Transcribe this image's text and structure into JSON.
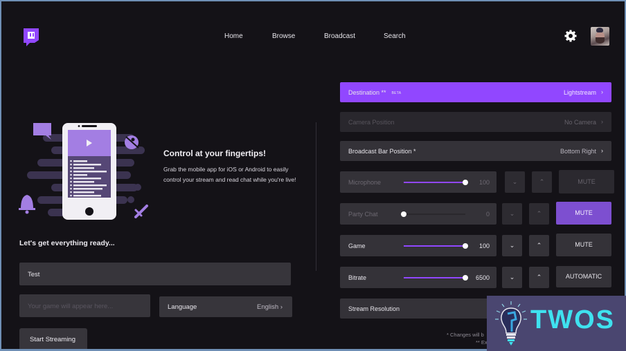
{
  "nav": {
    "links": [
      "Home",
      "Browse",
      "Broadcast",
      "Search"
    ],
    "icons": {
      "logo": "twitch-logo-icon",
      "settings": "gear-icon",
      "avatar": "user-avatar"
    }
  },
  "promo": {
    "title": "Control at your fingertips!",
    "text": "Grab the mobile app for iOS or Android to easily control your stream and read chat while you're live!"
  },
  "setup": {
    "heading": "Let's get everything ready...",
    "title_value": "Test",
    "game_placeholder": "Your game will appear here...",
    "language_label": "Language",
    "language_value": "English",
    "start_button": "Start Streaming"
  },
  "settings": {
    "destination": {
      "label": "Destination **",
      "badge": "BETA",
      "value": "Lightstream"
    },
    "camera": {
      "label": "Camera Position",
      "value": "No Camera"
    },
    "broadcast_bar": {
      "label": "Broadcast Bar Position *",
      "value": "Bottom Right"
    },
    "sliders": [
      {
        "label": "Microphone",
        "value": "100",
        "fraction": 1.0,
        "action": "MUTE",
        "state": "disabled"
      },
      {
        "label": "Party Chat",
        "value": "0",
        "fraction": 0.0,
        "action": "MUTE",
        "state": "muted"
      },
      {
        "label": "Game",
        "value": "100",
        "fraction": 1.0,
        "action": "MUTE",
        "state": "normal"
      },
      {
        "label": "Bitrate",
        "value": "6500",
        "fraction": 1.0,
        "action": "AUTOMATIC",
        "state": "normal"
      }
    ],
    "stream_resolution": {
      "label": "Stream Resolution"
    },
    "notes": [
      "* Changes will b",
      "** Ex"
    ]
  },
  "watermark": {
    "text": "TWOS"
  },
  "colors": {
    "accent": "#9147ff",
    "mute_active": "#7d4fd0",
    "background": "#141217",
    "panel": "#343238"
  }
}
